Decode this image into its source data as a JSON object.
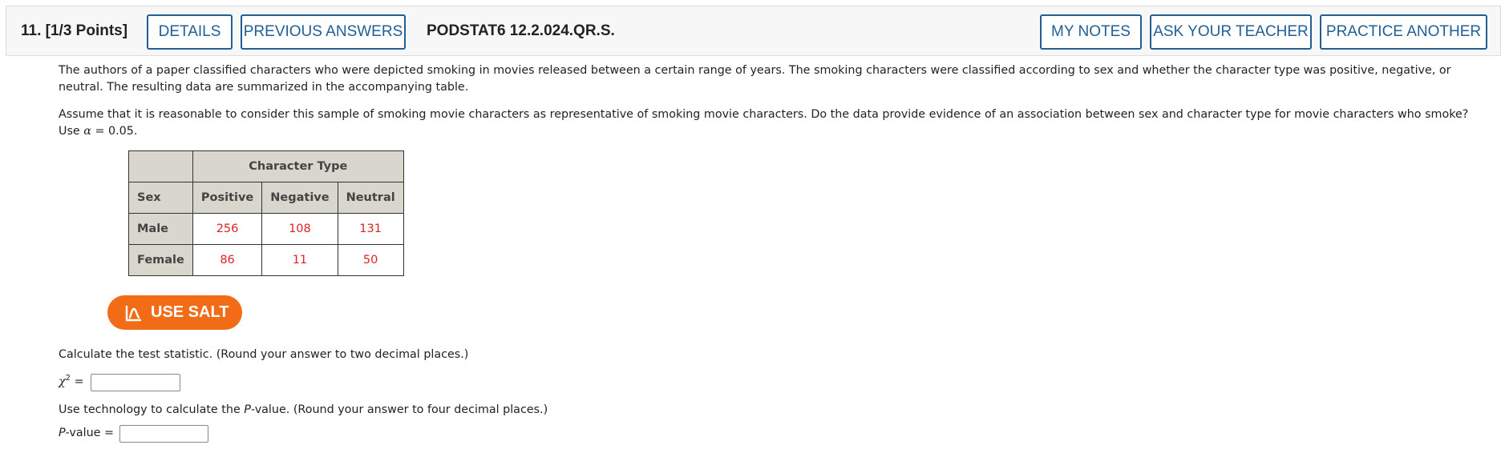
{
  "header": {
    "question_number": "11.",
    "points": "[1/3 Points]",
    "details_label": "DETAILS",
    "previous_answers_label": "PREVIOUS ANSWERS",
    "question_code": "PODSTAT6 12.2.024.QR.S.",
    "my_notes_label": "MY NOTES",
    "ask_teacher_label": "ASK YOUR TEACHER",
    "practice_another_label": "PRACTICE ANOTHER"
  },
  "question": {
    "paragraph1": "The authors of a paper classified characters who were depicted smoking in movies released between a certain range of years. The smoking characters were classified according to sex and whether the character type was positive, negative, or neutral. The resulting data are summarized in the accompanying table.",
    "paragraph2_main": "Assume that it is reasonable to consider this sample of smoking movie characters as representative of smoking movie characters. Do the data provide evidence of an association between sex and character type for movie characters who smoke? Use ",
    "alpha_symbol": "α",
    "alpha_value": " = 0.05."
  },
  "table": {
    "group_header": "Character Type",
    "row_header": "Sex",
    "columns": [
      "Positive",
      "Negative",
      "Neutral"
    ],
    "rows": [
      {
        "label": "Male",
        "values": [
          "256",
          "108",
          "131"
        ]
      },
      {
        "label": "Female",
        "values": [
          "86",
          "11",
          "50"
        ]
      }
    ]
  },
  "salt_button_label": "USE SALT",
  "part1": {
    "prompt": "Calculate the test statistic. (Round your answer to two decimal places.)",
    "symbol": "χ",
    "superscript": "2",
    "equals": " =",
    "value": ""
  },
  "part2": {
    "prompt_before": "Use technology to calculate the ",
    "prompt_italic": "P",
    "prompt_after": "-value. (Round your answer to four decimal places.)",
    "label_italic": "P",
    "label_rest": "-value =",
    "value": ""
  },
  "colors": {
    "accent_blue": "#1f5f96",
    "salt_orange": "#f26b16",
    "data_red": "#dd2222",
    "table_shade": "#d9d6ce"
  }
}
